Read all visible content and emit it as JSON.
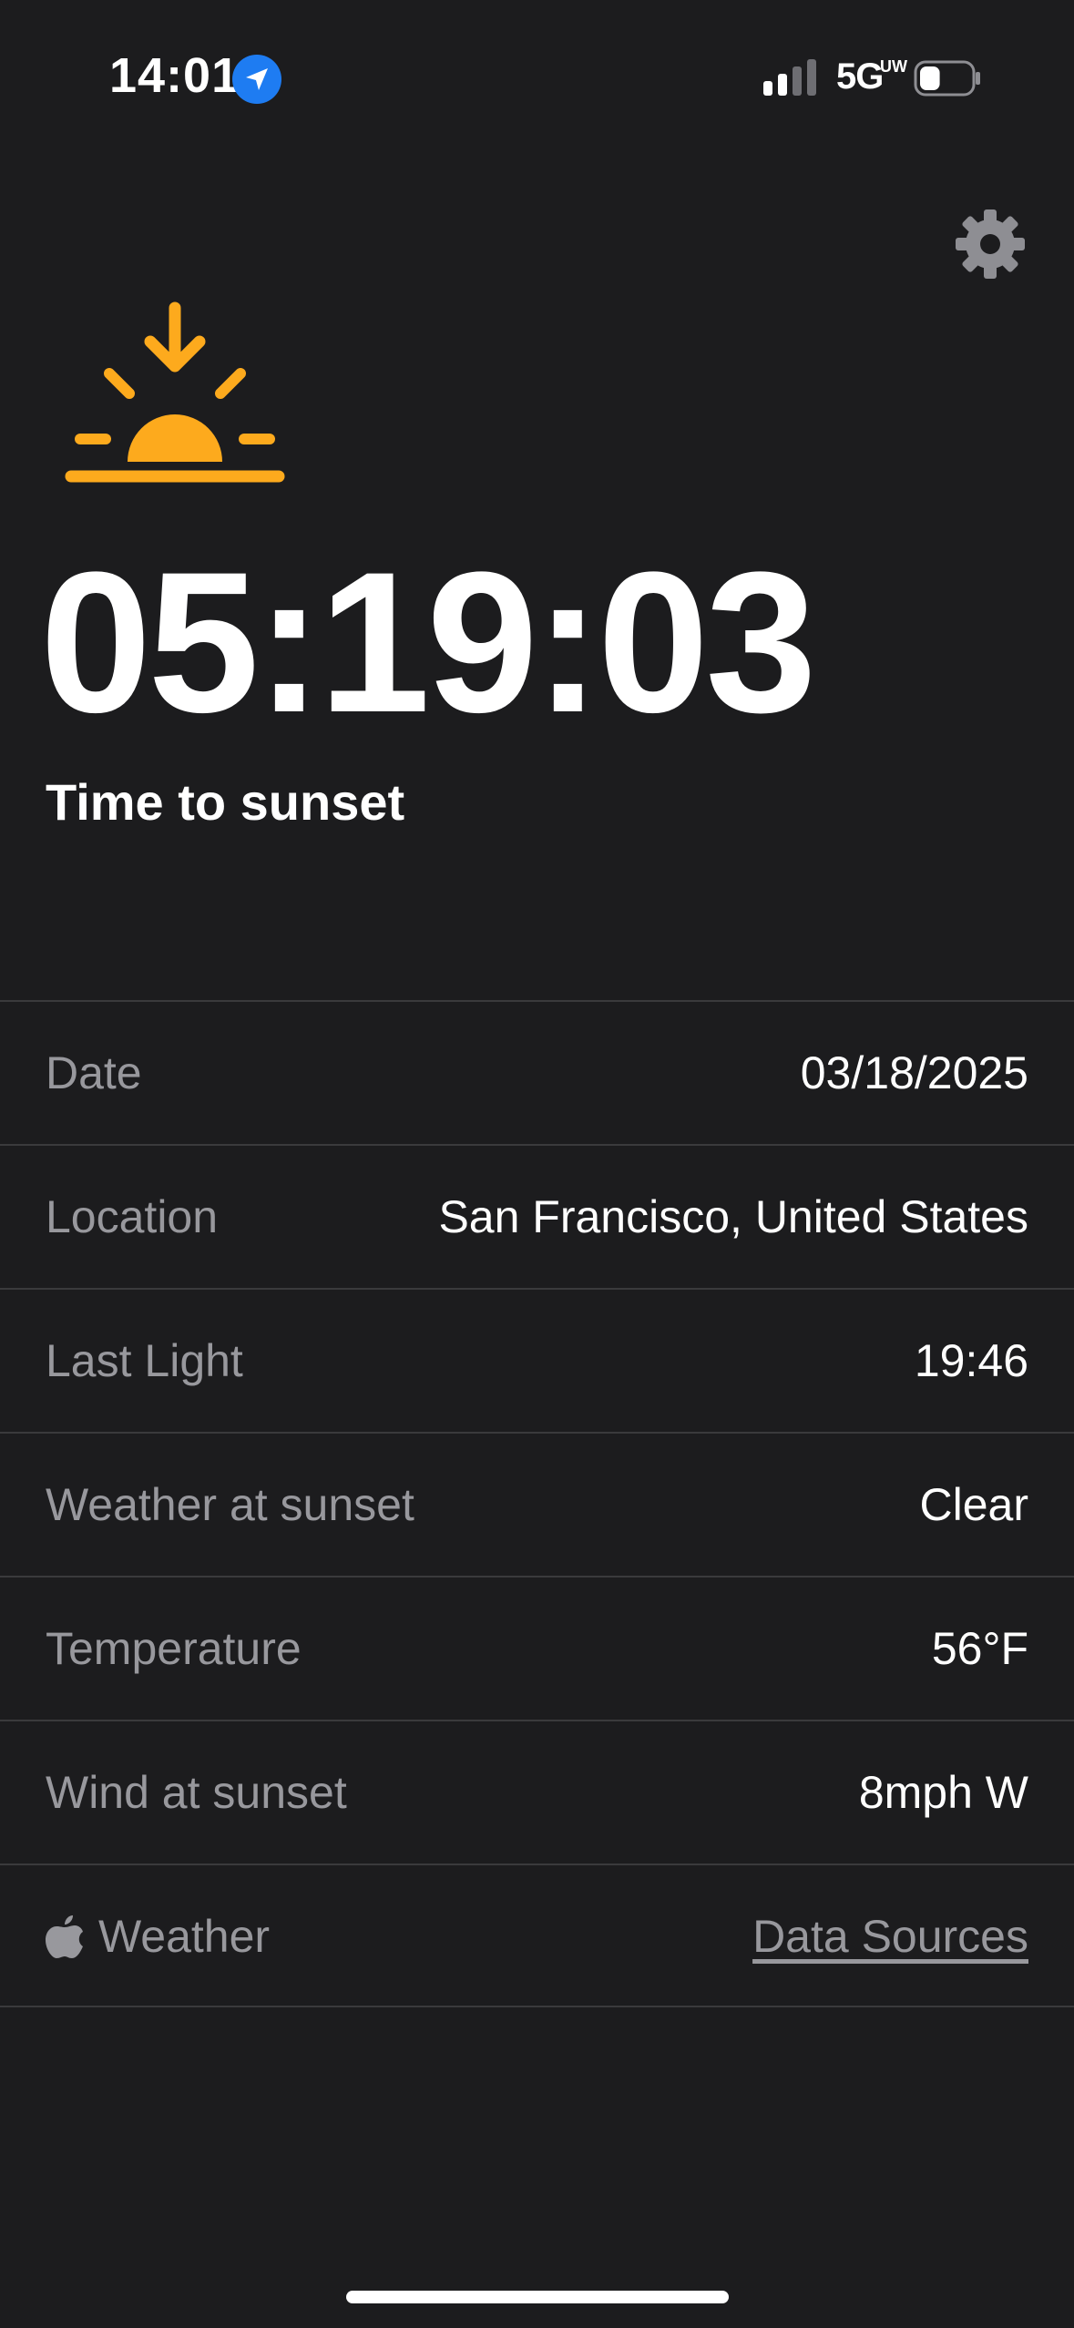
{
  "status_bar": {
    "time": "14:01",
    "network": "5G",
    "network_suffix": "UW",
    "battery_level": 0.4
  },
  "icons": {
    "settings": "gear-icon",
    "sunset": "sunset-icon",
    "location": "location-arrow-icon",
    "brand": "apple-icon"
  },
  "colors": {
    "background": "#1c1c1e",
    "accent": "#fdaa1d",
    "label": "#98989d",
    "separator": "#3a3a3c"
  },
  "hero": {
    "countdown": "05:19:03",
    "caption": "Time to sunset"
  },
  "details": [
    {
      "label": "Date",
      "value": "03/18/2025"
    },
    {
      "label": "Location",
      "value": "San Francisco, United States"
    },
    {
      "label": "Last Light",
      "value": "19:46"
    },
    {
      "label": "Weather at sunset",
      "value": "Clear"
    },
    {
      "label": "Temperature",
      "value": "56°F"
    },
    {
      "label": "Wind at sunset",
      "value": "8mph W"
    }
  ],
  "footer": {
    "brand": "Weather",
    "link": "Data Sources"
  }
}
